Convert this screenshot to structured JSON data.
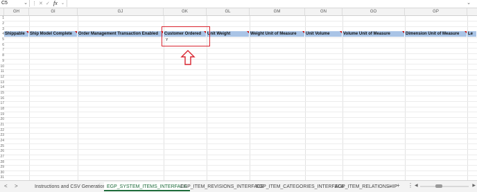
{
  "formula_bar": {
    "name_box": "C5",
    "fx": "fx",
    "value": ""
  },
  "columns": [
    "GH",
    "GI",
    "GJ",
    "GK",
    "GL",
    "GM",
    "GN",
    "GO",
    "GP"
  ],
  "header_row": [
    "Shippable",
    "Ship Model Complete",
    "Order Management Transaction Enabled",
    "Customer Ordered",
    "Unit Weight",
    "Weight Unit of Measure",
    "Unit Volume",
    "Volume Unit of Measure",
    "Dimension Unit of Measure",
    "Le"
  ],
  "data_row": {
    "customer_ordered": "Y"
  },
  "row_numbers": [
    "1",
    "2",
    "3",
    "4",
    "5",
    "6",
    "7",
    "8",
    "9",
    "10",
    "11",
    "12",
    "13",
    "14",
    "15",
    "16",
    "17",
    "18",
    "19",
    "20",
    "21",
    "22",
    "23",
    "24",
    "25",
    "26",
    "27",
    "28",
    "29",
    "30",
    "31"
  ],
  "tabs": {
    "prev": "<",
    "next": ">",
    "items": [
      "Instructions and CSV Generation",
      "EGP_SYSTEM_ITEMS_INTERFACE",
      "EGP_ITEM_REVISIONS_INTERFACE",
      "EGP_ITEM_CATEGORIES_INTERFACE",
      "EGP_ITEM_RELATIONSHIP"
    ],
    "more": "...",
    "add": "+",
    "options": "⋮"
  }
}
